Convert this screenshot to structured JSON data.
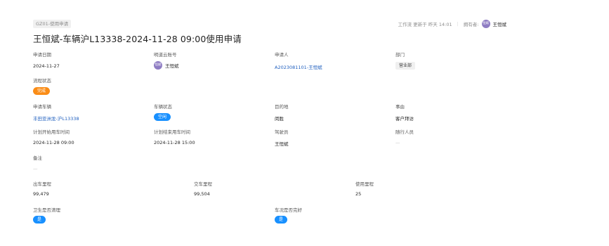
{
  "header": {
    "form_tag": "GZ01-使用申请",
    "workflow_text": "工作流 更新于 昨天 14:01",
    "owner_label": "拥有者:",
    "owner_avatar": "恒斌",
    "owner_name": "王恒斌",
    "title": "王恒斌-车辆沪L13338-2024-11-28 09:00使用申请"
  },
  "fields": {
    "apply_date": {
      "label": "申请日期",
      "value": "2024-11-27"
    },
    "mingdao_account": {
      "label": "明道云账号",
      "avatar": "恒斌",
      "value": "王恒斌"
    },
    "applicant": {
      "label": "申请人",
      "value": "A2023081101-王恒斌"
    },
    "department": {
      "label": "部门",
      "value": "营业部"
    },
    "process_status": {
      "label": "流程状态",
      "value": "完成"
    },
    "vehicle": {
      "label": "申请车辆",
      "value": "丰田亚洲龙-沪L13338"
    },
    "vehicle_status": {
      "label": "车辆状态",
      "value": "空闲"
    },
    "destination": {
      "label": "目的地",
      "value": "闵胜"
    },
    "reason": {
      "label": "事由",
      "value": "客户拜访"
    },
    "planned_start": {
      "label": "计划开始用车时间",
      "value": "2024-11-28 09:00"
    },
    "planned_end": {
      "label": "计划结束用车时间",
      "value": "2024-11-28 15:00"
    },
    "driver": {
      "label": "驾驶员",
      "value": "王恒斌"
    },
    "companions": {
      "label": "随行人员",
      "value": "—"
    },
    "remarks": {
      "label": "备注",
      "value": "—"
    },
    "out_mileage": {
      "label": "出车里程",
      "value": "99,479"
    },
    "return_mileage": {
      "label": "交车里程",
      "value": "99,504"
    },
    "used_mileage": {
      "label": "使用里程",
      "value": "25"
    },
    "hygiene_clean": {
      "label": "卫生是否清理",
      "value": "是"
    },
    "vehicle_intact": {
      "label": "车况是否完好",
      "value": "是"
    }
  },
  "colors": {
    "link": "#1f5fbf",
    "status_orange": "#fa8c16",
    "status_blue": "#1890ff",
    "avatar_purple": "#8e7cc3"
  }
}
